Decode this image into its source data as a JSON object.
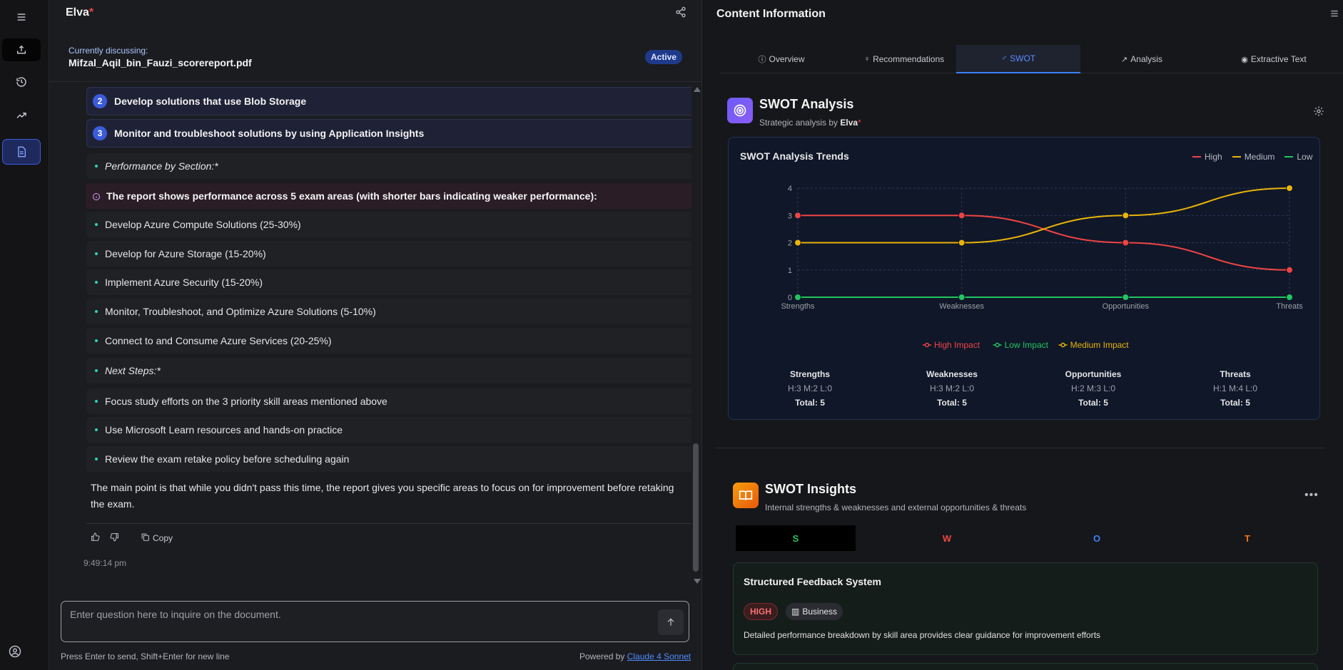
{
  "app": {
    "brand": "Elva",
    "brand_mark": "*"
  },
  "chat": {
    "discussing_label": "Currently discussing:",
    "file_name": "Mifzal_Aqil_bin_Fauzi_scorereport.pdf",
    "status_badge": "Active",
    "numbered_items": [
      {
        "num": "2",
        "text": "Develop solutions that use Blob Storage"
      },
      {
        "num": "3",
        "text": "Monitor and troubleshoot solutions by using Application Insights"
      }
    ],
    "section_performance": "Performance by Section:*",
    "note": "The report shows performance across 5 exam areas (with shorter bars indicating weaker performance):",
    "areas": [
      "Develop Azure Compute Solutions (25-30%)",
      "Develop for Azure Storage (15-20%)",
      "Implement Azure Security (15-20%)",
      "Monitor, Troubleshoot, and Optimize Azure Solutions (5-10%)",
      "Connect to and Consume Azure Services (20-25%)"
    ],
    "section_next": "Next Steps:*",
    "next_steps": [
      "Focus study efforts on the 3 priority skill areas mentioned above",
      "Use Microsoft Learn resources and hands-on practice",
      "Review the exam retake policy before scheduling again"
    ],
    "summary": "The main point is that while you didn't pass this time, the report gives you specific areas to focus on for improvement before retaking the exam.",
    "copy_label": "Copy",
    "timestamp": "9:49:14 pm",
    "input_placeholder": "Enter question here to inquire on the document.",
    "hint": "Press Enter to send, Shift+Enter for new line",
    "powered_prefix": "Powered by",
    "powered_model": "Claude 4 Sonnet"
  },
  "panel": {
    "title": "Content Information",
    "tabs": [
      {
        "icon": "ⓘ",
        "label": "Overview"
      },
      {
        "icon": "♀",
        "label": "Recommendations"
      },
      {
        "icon": "♂",
        "label": "SWOT"
      },
      {
        "icon": "↗",
        "label": "Analysis"
      },
      {
        "icon": "◉",
        "label": "Extractive Text"
      }
    ],
    "active_tab": "SWOT",
    "swot_title": "SWOT Analysis",
    "swot_sub_prefix": "Strategic analysis by",
    "swot_sub_name": "Elva",
    "swot_sub_mark": "*",
    "insights_title": "SWOT Insights",
    "insights_sub": "Internal strengths & weaknesses and external opportunities & threats",
    "swot_letters": [
      {
        "letter": "S",
        "color": "#22c55e"
      },
      {
        "letter": "W",
        "color": "#ef4444"
      },
      {
        "letter": "O",
        "color": "#3b82f6"
      },
      {
        "letter": "T",
        "color": "#f97316"
      }
    ],
    "insight": {
      "title": "Structured Feedback System",
      "impact": "HIGH",
      "category": "Business",
      "description": "Detailed performance breakdown by skill area provides clear guidance for improvement efforts"
    }
  },
  "chart_data": {
    "type": "line",
    "title": "SWOT Analysis Trends",
    "categories": [
      "Strengths",
      "Weaknesses",
      "Opportunities",
      "Threats"
    ],
    "series": [
      {
        "name": "High",
        "color": "#ef4444",
        "values": [
          3,
          3,
          2,
          1
        ]
      },
      {
        "name": "Medium",
        "color": "#eab308",
        "values": [
          2,
          2,
          3,
          4
        ]
      },
      {
        "name": "Low",
        "color": "#22c55e",
        "values": [
          0,
          0,
          0,
          0
        ]
      }
    ],
    "bottom_legend": [
      {
        "name": "High Impact",
        "color": "#ef4444"
      },
      {
        "name": "Low Impact",
        "color": "#22c55e"
      },
      {
        "name": "Medium Impact",
        "color": "#eab308"
      }
    ],
    "ylim": [
      0,
      4
    ],
    "yticks": [
      0,
      1,
      2,
      3,
      4
    ],
    "grid": true,
    "legend_placement": "top-right",
    "summary": [
      {
        "name": "Strengths",
        "counts": "H:3 M:2 L:0",
        "total": "Total: 5"
      },
      {
        "name": "Weaknesses",
        "counts": "H:3 M:2 L:0",
        "total": "Total: 5"
      },
      {
        "name": "Opportunities",
        "counts": "H:2 M:3 L:0",
        "total": "Total: 5"
      },
      {
        "name": "Threats",
        "counts": "H:1 M:4 L:0",
        "total": "Total: 5"
      }
    ]
  }
}
